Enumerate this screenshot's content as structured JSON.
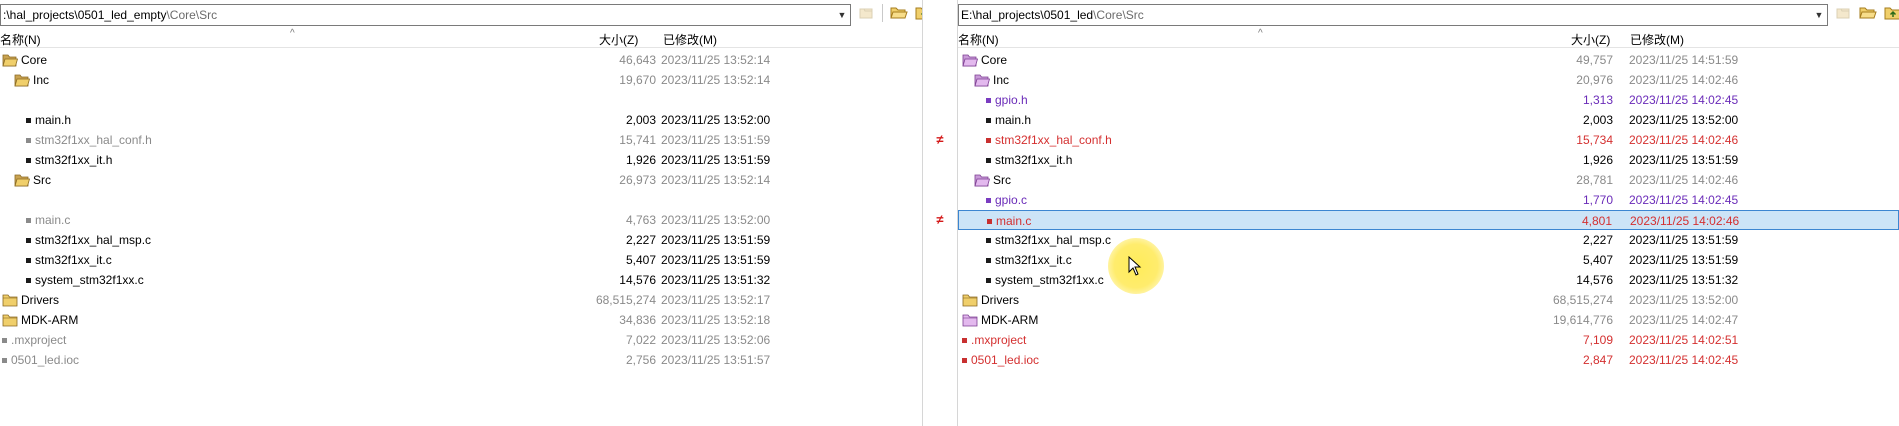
{
  "left": {
    "path_bright": ":\\hal_projects\\0501_led_empty",
    "path_dim": "\\Core\\Src",
    "headers": {
      "name": "名称(N)",
      "size": "大小(Z)",
      "date": "已修改(M)"
    },
    "rows": [
      {
        "name": "Core",
        "kind": "folder-open",
        "indent": 0,
        "size": "46,643",
        "date": "2023/11/25 13:52:14",
        "color": "gray",
        "name_color": "black"
      },
      {
        "name": "Inc",
        "kind": "folder-open",
        "indent": 1,
        "size": "19,670",
        "date": "2023/11/25 13:52:14",
        "color": "gray",
        "name_color": "black"
      },
      {
        "name": "",
        "kind": "blank",
        "indent": 2,
        "size": "",
        "date": "",
        "color": "gray",
        "name_color": "black"
      },
      {
        "name": "main.h",
        "kind": "file",
        "indent": 2,
        "size": "2,003",
        "date": "2023/11/25 13:52:00",
        "color": "black",
        "name_color": "black"
      },
      {
        "name": "stm32f1xx_hal_conf.h",
        "kind": "file",
        "indent": 2,
        "size": "15,741",
        "date": "2023/11/25 13:51:59",
        "color": "gray",
        "name_color": "gray"
      },
      {
        "name": "stm32f1xx_it.h",
        "kind": "file",
        "indent": 2,
        "size": "1,926",
        "date": "2023/11/25 13:51:59",
        "color": "black",
        "name_color": "black"
      },
      {
        "name": "Src",
        "kind": "folder-open",
        "indent": 1,
        "size": "26,973",
        "date": "2023/11/25 13:52:14",
        "color": "gray",
        "name_color": "black"
      },
      {
        "name": "",
        "kind": "blank",
        "indent": 2,
        "size": "",
        "date": "",
        "color": "gray",
        "name_color": "black"
      },
      {
        "name": "main.c",
        "kind": "file",
        "indent": 2,
        "size": "4,763",
        "date": "2023/11/25 13:52:00",
        "color": "gray",
        "name_color": "gray"
      },
      {
        "name": "stm32f1xx_hal_msp.c",
        "kind": "file",
        "indent": 2,
        "size": "2,227",
        "date": "2023/11/25 13:51:59",
        "color": "black",
        "name_color": "black"
      },
      {
        "name": "stm32f1xx_it.c",
        "kind": "file",
        "indent": 2,
        "size": "5,407",
        "date": "2023/11/25 13:51:59",
        "color": "black",
        "name_color": "black"
      },
      {
        "name": "system_stm32f1xx.c",
        "kind": "file",
        "indent": 2,
        "size": "14,576",
        "date": "2023/11/25 13:51:32",
        "color": "black",
        "name_color": "black"
      },
      {
        "name": "Drivers",
        "kind": "folder",
        "indent": 0,
        "size": "68,515,274",
        "date": "2023/11/25 13:52:17",
        "color": "gray",
        "name_color": "black"
      },
      {
        "name": "MDK-ARM",
        "kind": "folder",
        "indent": 0,
        "size": "34,836",
        "date": "2023/11/25 13:52:18",
        "color": "gray",
        "name_color": "black"
      },
      {
        "name": ".mxproject",
        "kind": "file",
        "indent": 0,
        "size": "7,022",
        "date": "2023/11/25 13:52:06",
        "color": "gray",
        "name_color": "gray"
      },
      {
        "name": "0501_led.ioc",
        "kind": "file",
        "indent": 0,
        "size": "2,756",
        "date": "2023/11/25 13:51:57",
        "color": "gray",
        "name_color": "gray"
      }
    ]
  },
  "right": {
    "path_bright": "E:\\hal_projects\\0501_led",
    "path_dim": "\\Core\\Src",
    "headers": {
      "name": "名称(N)",
      "size": "大小(Z)",
      "date": "已修改(M)"
    },
    "rows": [
      {
        "name": "Core",
        "kind": "folder-open-purple",
        "indent": 0,
        "size": "49,757",
        "date": "2023/11/25 14:51:59",
        "color": "gray",
        "name_color": "black"
      },
      {
        "name": "Inc",
        "kind": "folder-open-purple",
        "indent": 1,
        "size": "20,976",
        "date": "2023/11/25 14:02:46",
        "color": "gray",
        "name_color": "black"
      },
      {
        "name": "gpio.h",
        "kind": "file-purple",
        "indent": 2,
        "size": "1,313",
        "date": "2023/11/25 14:02:45",
        "color": "purple",
        "name_color": "purple"
      },
      {
        "name": "main.h",
        "kind": "file",
        "indent": 2,
        "size": "2,003",
        "date": "2023/11/25 13:52:00",
        "color": "black",
        "name_color": "black"
      },
      {
        "name": "stm32f1xx_hal_conf.h",
        "kind": "file-red",
        "indent": 2,
        "size": "15,734",
        "date": "2023/11/25 14:02:46",
        "color": "red",
        "name_color": "red"
      },
      {
        "name": "stm32f1xx_it.h",
        "kind": "file",
        "indent": 2,
        "size": "1,926",
        "date": "2023/11/25 13:51:59",
        "color": "black",
        "name_color": "black"
      },
      {
        "name": "Src",
        "kind": "folder-open-purple",
        "indent": 1,
        "size": "28,781",
        "date": "2023/11/25 14:02:46",
        "color": "gray",
        "name_color": "black"
      },
      {
        "name": "gpio.c",
        "kind": "file-purple",
        "indent": 2,
        "size": "1,770",
        "date": "2023/11/25 14:02:45",
        "color": "purple",
        "name_color": "purple"
      },
      {
        "name": "main.c",
        "kind": "file-red",
        "indent": 2,
        "size": "4,801",
        "date": "2023/11/25 14:02:46",
        "color": "red",
        "name_color": "red",
        "selected": true
      },
      {
        "name": "stm32f1xx_hal_msp.c",
        "kind": "file",
        "indent": 2,
        "size": "2,227",
        "date": "2023/11/25 13:51:59",
        "color": "black",
        "name_color": "black"
      },
      {
        "name": "stm32f1xx_it.c",
        "kind": "file",
        "indent": 2,
        "size": "5,407",
        "date": "2023/11/25 13:51:59",
        "color": "black",
        "name_color": "black"
      },
      {
        "name": "system_stm32f1xx.c",
        "kind": "file",
        "indent": 2,
        "size": "14,576",
        "date": "2023/11/25 13:51:32",
        "color": "black",
        "name_color": "black"
      },
      {
        "name": "Drivers",
        "kind": "folder",
        "indent": 0,
        "size": "68,515,274",
        "date": "2023/11/25 13:52:00",
        "color": "gray",
        "name_color": "black"
      },
      {
        "name": "MDK-ARM",
        "kind": "folder-purple",
        "indent": 0,
        "size": "19,614,776",
        "date": "2023/11/25 14:02:47",
        "color": "gray",
        "name_color": "black"
      },
      {
        "name": ".mxproject",
        "kind": "file-red",
        "indent": 0,
        "size": "7,109",
        "date": "2023/11/25 14:02:51",
        "color": "red",
        "name_color": "red"
      },
      {
        "name": "0501_led.ioc",
        "kind": "file-red",
        "indent": 0,
        "size": "2,847",
        "date": "2023/11/25 14:02:45",
        "color": "red",
        "name_color": "red"
      }
    ]
  },
  "diff_markers": [
    {
      "row": 4,
      "symbol": "≠"
    },
    {
      "row": 8,
      "symbol": "≠"
    }
  ],
  "colors": {
    "selection_bg": "#cce4f7",
    "selection_border": "#3c86d1",
    "diff_red": "#d43030",
    "orphan_purple": "#6a2bb8",
    "dim_gray": "#8a8a8a"
  },
  "icons": [
    "folder-open-icon",
    "folder-up-icon",
    "parent-folder-icon",
    "refresh-icon",
    "back-icon",
    "forward-icon"
  ]
}
